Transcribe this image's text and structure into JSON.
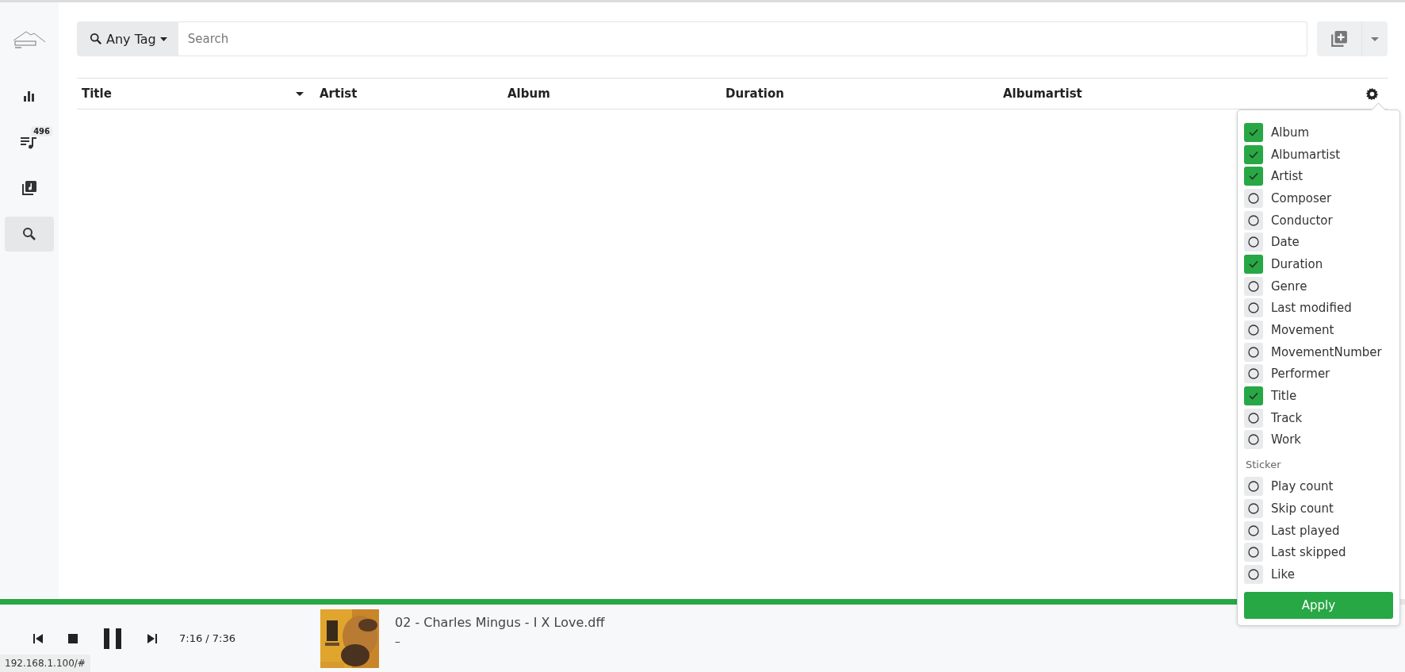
{
  "sidebar": {
    "items": [
      {
        "kind": "stats",
        "selected": false
      },
      {
        "kind": "queue",
        "badge": "496",
        "selected": false
      },
      {
        "kind": "library",
        "selected": false
      },
      {
        "kind": "search",
        "selected": true
      }
    ]
  },
  "search": {
    "tag_button": "Any Tag",
    "placeholder": "Search"
  },
  "table": {
    "columns": [
      {
        "label": "Title",
        "sorted": true
      },
      {
        "label": "Artist",
        "sorted": false
      },
      {
        "label": "Album",
        "sorted": false
      },
      {
        "label": "Duration",
        "sorted": false
      },
      {
        "label": "Albumartist",
        "sorted": false
      }
    ]
  },
  "column_menu": {
    "tags": [
      {
        "label": "Album",
        "checked": true
      },
      {
        "label": "Albumartist",
        "checked": true
      },
      {
        "label": "Artist",
        "checked": true
      },
      {
        "label": "Composer",
        "checked": false
      },
      {
        "label": "Conductor",
        "checked": false
      },
      {
        "label": "Date",
        "checked": false
      },
      {
        "label": "Duration",
        "checked": true
      },
      {
        "label": "Genre",
        "checked": false
      },
      {
        "label": "Last modified",
        "checked": false
      },
      {
        "label": "Movement",
        "checked": false
      },
      {
        "label": "MovementNumber",
        "checked": false
      },
      {
        "label": "Performer",
        "checked": false
      },
      {
        "label": "Title",
        "checked": true
      },
      {
        "label": "Track",
        "checked": false
      },
      {
        "label": "Work",
        "checked": false
      }
    ],
    "sticker_heading": "Sticker",
    "stickers": [
      {
        "label": "Play count",
        "checked": false
      },
      {
        "label": "Skip count",
        "checked": false
      },
      {
        "label": "Last played",
        "checked": false
      },
      {
        "label": "Last skipped",
        "checked": false
      },
      {
        "label": "Like",
        "checked": false
      }
    ],
    "apply": "Apply"
  },
  "player": {
    "progress": {
      "level": 0.96
    },
    "playing": true,
    "time": "7:16 / 7:36",
    "track": "02 - Charles Mingus - I X Love.dff",
    "subtitle": "–"
  },
  "status_url": "192.168.1.100/#"
}
